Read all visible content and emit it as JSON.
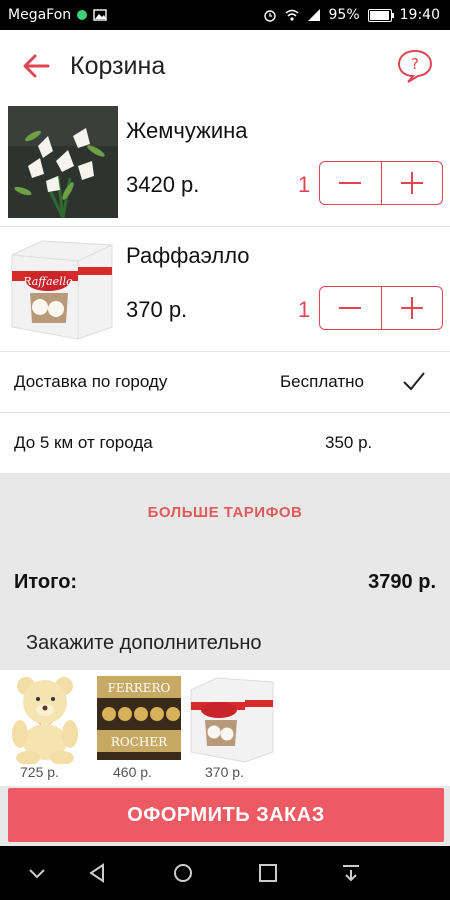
{
  "status_bar": {
    "carrier": "MegaFon",
    "battery": "95%",
    "time": "19:40"
  },
  "app_bar": {
    "title": "Корзина"
  },
  "cart": [
    {
      "name": "Жемчужина",
      "price": "3420 р.",
      "qty": "1"
    },
    {
      "name": "Раффаэлло",
      "price": "370 р.",
      "qty": "1"
    }
  ],
  "delivery": [
    {
      "label": "Доставка по городу",
      "value": "Бесплатно",
      "selected": true
    },
    {
      "label": "До 5 км от города",
      "value": "350 р.",
      "selected": false
    }
  ],
  "more_tariffs": "БОЛЬШЕ ТАРИФОВ",
  "total": {
    "label": "Итого:",
    "value": "3790 р."
  },
  "extras": {
    "heading": "Закажите дополнительно",
    "items": [
      {
        "price": "725 р."
      },
      {
        "price": "460 р."
      },
      {
        "price": "370 р."
      }
    ]
  },
  "order_button": "ОФОРМИТЬ ЗАКАЗ",
  "colors": {
    "accent": "#e04552",
    "button": "#ee5a63",
    "panel": "#e8e8e8"
  }
}
